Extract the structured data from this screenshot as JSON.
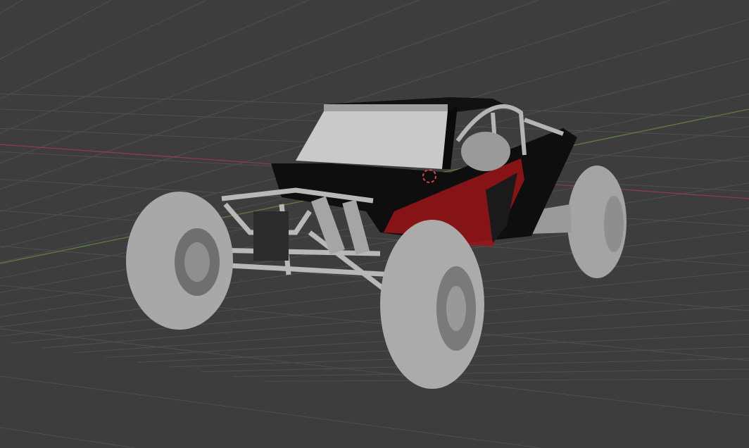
{
  "viewport": {
    "background": "#3d3d3d",
    "grid_color": "#4f4f4f",
    "x_axis_color": "#8a3f46",
    "y_axis_color": "#5f7f3a",
    "model": {
      "name_icon": "buggy-model",
      "body_color": "#0d0d0d",
      "accent_color": "#b0161b",
      "frame_color": "#b4b4b4",
      "tire_color": "#a9a9a9"
    },
    "cursor_icon": "3d-cursor"
  }
}
